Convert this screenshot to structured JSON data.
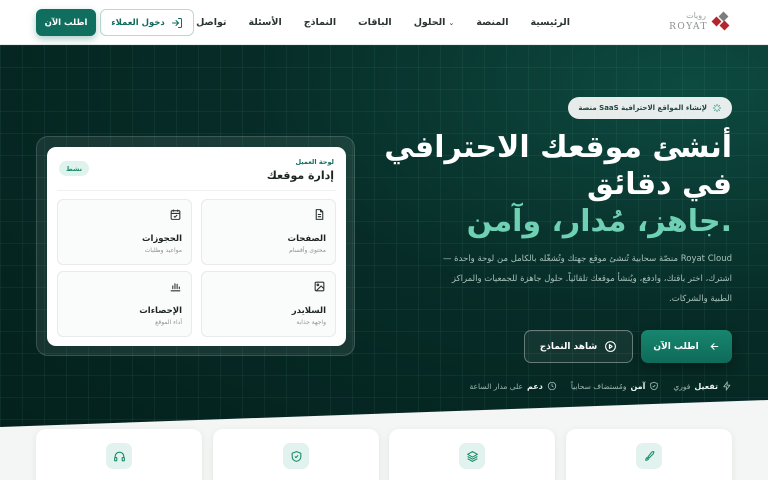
{
  "header": {
    "logo_text": "ROYAT",
    "logo_ar": "رويات",
    "nav": [
      {
        "label": "الرئيسية"
      },
      {
        "label": "المنصة"
      },
      {
        "label": "الحلول",
        "has_dropdown": true
      },
      {
        "label": "الباقات"
      },
      {
        "label": "النماذج"
      },
      {
        "label": "الأسئلة"
      },
      {
        "label": "تواصل"
      }
    ],
    "login_label": "دخول العملاء",
    "order_label": "اطلب الآن"
  },
  "hero": {
    "badge": "منصة SaaS لإنشاء المواقع الاحترافية",
    "title_line1": "أنشئ موقعك الاحترافي",
    "title_line2": "في دقائق",
    "title_accent": "جاهز، مُدار، وآمن.",
    "description": "Royat Cloud منصّة سحابية تُنشئ موقع جهتك وتُشغّله بالكامل من لوحة واحدة — اشترك، اختر باقتك، وادفع، ويُنشأ موقعك تلقائياً. حلول جاهزة للجمعيات والمراكز الطبية والشركات.",
    "order_button": "اطلب الآن",
    "samples_button": "شاهد النماذج",
    "features": [
      {
        "bold": "تفعيل",
        "text": "فوري",
        "icon": "lightning-icon"
      },
      {
        "bold": "آمن",
        "text": "ومُستضاف سحابياً",
        "icon": "shield-icon"
      },
      {
        "bold": "دعم",
        "text": "على مدار الساعة",
        "icon": "clock-icon"
      }
    ]
  },
  "dashboard": {
    "subtitle": "لوحة العميل",
    "title": "إدارة موقعك",
    "status": "نشط",
    "tiles": [
      {
        "title": "الصفحات",
        "subtitle": "محتوى وأقسام",
        "icon": "document-icon"
      },
      {
        "title": "الحجوزات",
        "subtitle": "مواعيد وطلبات",
        "icon": "calendar-check-icon"
      },
      {
        "title": "السلايدر",
        "subtitle": "واجهة جذابة",
        "icon": "image-icon"
      },
      {
        "title": "الإحصاءات",
        "subtitle": "أداء الموقع",
        "icon": "bar-chart-icon"
      }
    ]
  },
  "bottom_cards": [
    {
      "icon": "rocket-icon"
    },
    {
      "icon": "layers-icon"
    },
    {
      "icon": "shield-icon"
    },
    {
      "icon": "headset-icon"
    }
  ],
  "colors": {
    "brand": "#0f6e5e",
    "accent": "#6fd0b4",
    "hero_bg": "#072c27"
  }
}
